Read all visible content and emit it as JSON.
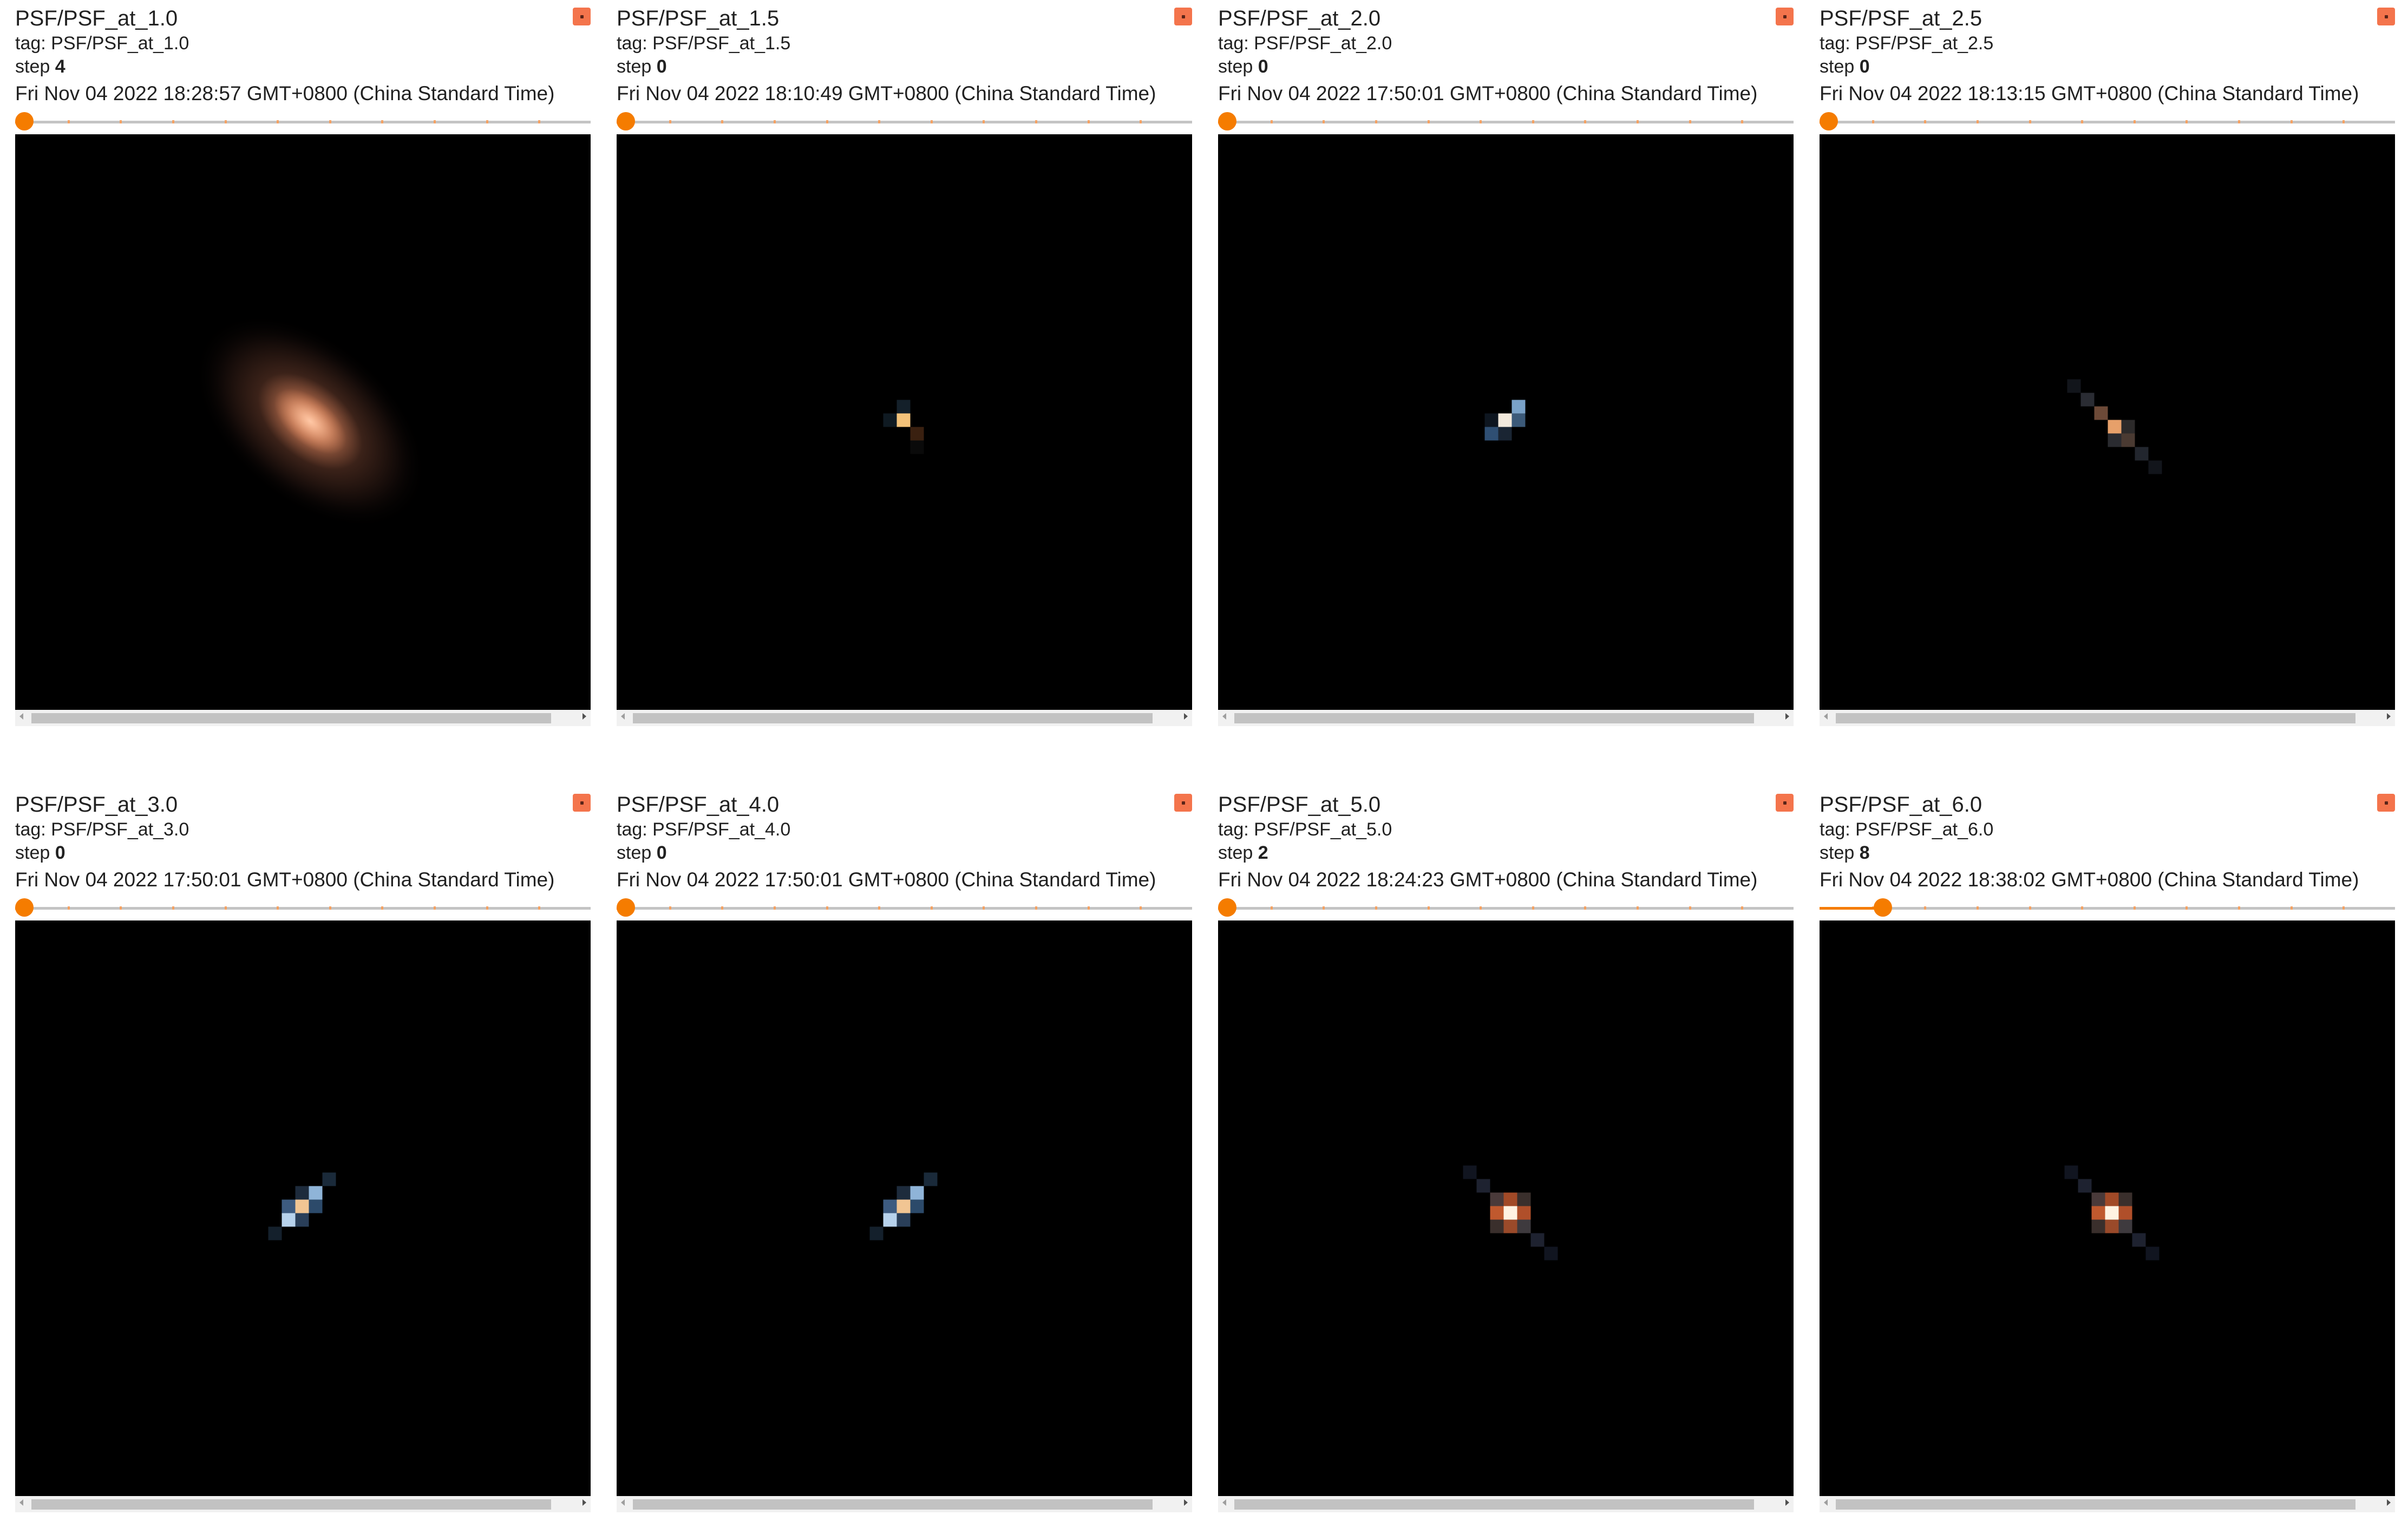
{
  "colors": {
    "accent": "#f57c00",
    "expand_button": "#f4744c",
    "image_bg": "#000000"
  },
  "cards": [
    {
      "title": "PSF/PSF_at_1.0",
      "tag": "tag: PSF/PSF_at_1.0",
      "step_label": "step",
      "step": "4",
      "date": "Fri Nov 04 2022 18:28:57 GMT+0800 (China Standard Time)",
      "slider_fraction": 0.0,
      "psf": "wide"
    },
    {
      "title": "PSF/PSF_at_1.5",
      "tag": "tag: PSF/PSF_at_1.5",
      "step_label": "step",
      "step": "0",
      "date": "Fri Nov 04 2022 18:10:49 GMT+0800 (China Standard Time)",
      "slider_fraction": 0.0,
      "psf": "tiny"
    },
    {
      "title": "PSF/PSF_at_2.0",
      "tag": "tag: PSF/PSF_at_2.0",
      "step_label": "step",
      "step": "0",
      "date": "Fri Nov 04 2022 17:50:01 GMT+0800 (China Standard Time)",
      "slider_fraction": 0.0,
      "psf": "small"
    },
    {
      "title": "PSF/PSF_at_2.5",
      "tag": "tag: PSF/PSF_at_2.5",
      "step_label": "step",
      "step": "0",
      "date": "Fri Nov 04 2022 18:13:15 GMT+0800 (China Standard Time)",
      "slider_fraction": 0.0,
      "psf": "streak"
    },
    {
      "title": "PSF/PSF_at_3.0",
      "tag": "tag: PSF/PSF_at_3.0",
      "step_label": "step",
      "step": "0",
      "date": "Fri Nov 04 2022 17:50:01 GMT+0800 (China Standard Time)",
      "slider_fraction": 0.0,
      "psf": "diag"
    },
    {
      "title": "PSF/PSF_at_4.0",
      "tag": "tag: PSF/PSF_at_4.0",
      "step_label": "step",
      "step": "0",
      "date": "Fri Nov 04 2022 17:50:01 GMT+0800 (China Standard Time)",
      "slider_fraction": 0.0,
      "psf": "diag"
    },
    {
      "title": "PSF/PSF_at_5.0",
      "tag": "tag: PSF/PSF_at_5.0",
      "step_label": "step",
      "step": "2",
      "date": "Fri Nov 04 2022 18:24:23 GMT+0800 (China Standard Time)",
      "slider_fraction": 0.0,
      "psf": "cross"
    },
    {
      "title": "PSF/PSF_at_6.0",
      "tag": "tag: PSF/PSF_at_6.0",
      "step_label": "step",
      "step": "8",
      "date": "Fri Nov 04 2022 18:38:02 GMT+0800 (China Standard Time)",
      "slider_fraction": 0.11,
      "psf": "cross"
    }
  ]
}
